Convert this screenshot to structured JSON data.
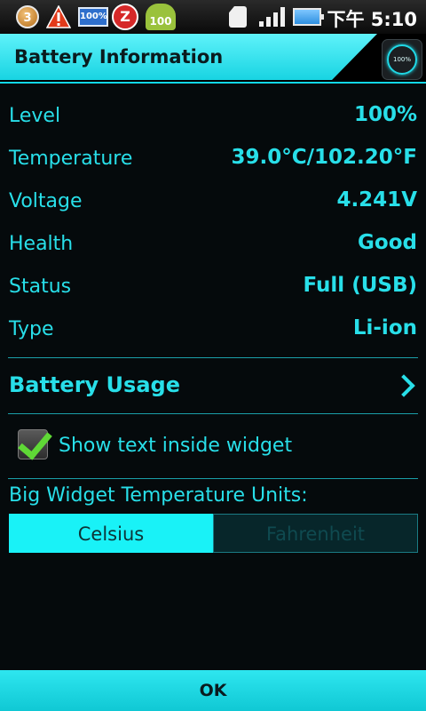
{
  "status_bar": {
    "notification_count": "3",
    "battery_widget_text": "100%",
    "alarm_glyph": "Z",
    "android_badge": "100",
    "time": "下午 5:10",
    "icons": [
      "notification-badge-icon",
      "warning-icon",
      "battery-widget-icon",
      "alarm-icon",
      "android-icon",
      "sim-icon",
      "signal-icon",
      "battery-icon"
    ]
  },
  "title_bar": {
    "title": "Battery Information",
    "gauge_text": "100%"
  },
  "info": {
    "rows": [
      {
        "label": "Level",
        "value": "100%"
      },
      {
        "label": "Temperature",
        "value": "39.0°C/102.20°F"
      },
      {
        "label": "Voltage",
        "value": "4.241V"
      },
      {
        "label": "Health",
        "value": "Good"
      },
      {
        "label": "Status",
        "value": "Full (USB)"
      },
      {
        "label": "Type",
        "value": "Li-ion"
      }
    ]
  },
  "usage": {
    "label": "Battery Usage"
  },
  "widget_option": {
    "label": "Show text inside widget",
    "checked": true
  },
  "units": {
    "label": "Big Widget Temperature Units:",
    "options": [
      "Celsius",
      "Fahrenheit"
    ],
    "selected": "Celsius"
  },
  "footer": {
    "ok_label": "OK"
  },
  "colors": {
    "accent": "#28dfe9",
    "background": "#050a0c",
    "check": "#5fd836"
  }
}
